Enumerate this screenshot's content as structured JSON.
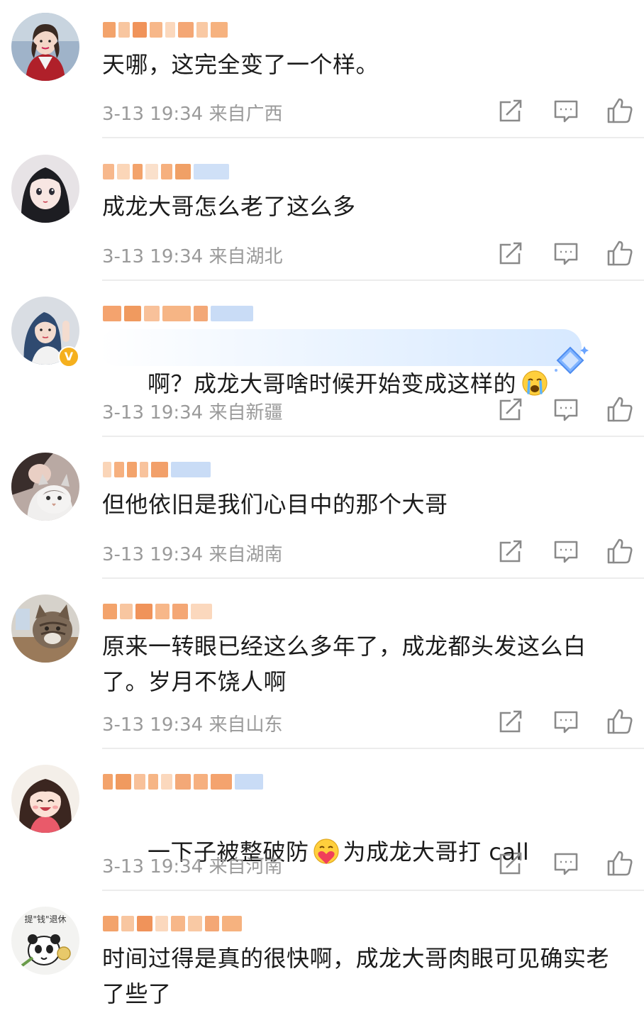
{
  "comments": [
    {
      "id": 1,
      "text": "天哪，这完全变了一个样。",
      "time": "3-13 19:34",
      "location": "来自广西",
      "avatar_icon": "avatar-girl-red-jacket",
      "verified": false
    },
    {
      "id": 2,
      "text": "成龙大哥怎么老了这么多",
      "time": "3-13 19:34",
      "location": "来自湖北",
      "avatar_icon": "avatar-anime-girl",
      "verified": false
    },
    {
      "id": 3,
      "text": "啊？成龙大哥啥时候开始变成这样的",
      "time": "3-13 19:34",
      "location": "来自新疆",
      "avatar_icon": "avatar-blue-hair-girl",
      "verified": true,
      "emoji": "crying-face-emoji"
    },
    {
      "id": 4,
      "text": "但他依旧是我们心目中的那个大哥",
      "time": "3-13 19:34",
      "location": "来自湖南",
      "avatar_icon": "avatar-cat-photo",
      "verified": false
    },
    {
      "id": 5,
      "text": "原来一转眼已经这么多年了，成龙都头发这么白了。岁月不饶人啊",
      "time": "3-13 19:34",
      "location": "来自山东",
      "avatar_icon": "avatar-tabby-cat",
      "verified": false
    },
    {
      "id": 6,
      "text_before": "一下子被整破防",
      "text_after": "为成龙大哥打 call",
      "time": "3-13 19:34",
      "location": "来自河南",
      "avatar_icon": "avatar-cartoon-girl",
      "verified": false,
      "emoji": "hugging-heart-emoji"
    },
    {
      "id": 7,
      "text": "时间过得是真的很快啊，成龙大哥肉眼可见确实老了些了",
      "avatar_icon": "avatar-panda-sticker",
      "avatar_caption": "提\"钱\"退休",
      "verified": false
    }
  ],
  "actions": {
    "share_icon": "share-icon",
    "comment_icon": "comment-icon",
    "like_icon": "thumbs-up-icon"
  },
  "colors": {
    "meta_text": "#9a9a9a",
    "icon_stroke": "#8a8a8a",
    "divider": "#ececec",
    "verified_badge": "#f5b01e"
  }
}
